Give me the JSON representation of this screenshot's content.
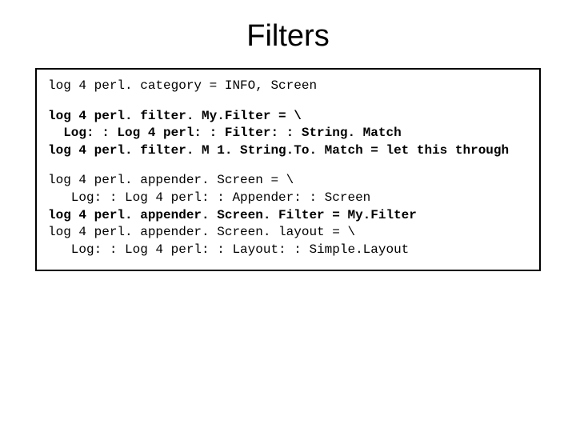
{
  "title": "Filters",
  "code": {
    "l1": "log 4 perl. category = INFO, Screen",
    "l2": "log 4 perl. filter. My.Filter = \\",
    "l3": "  Log: : Log 4 perl: : Filter: : String. Match",
    "l4": "log 4 perl. filter. M 1. String.To. Match = let this through",
    "l5": "log 4 perl. appender. Screen = \\",
    "l6": "   Log: : Log 4 perl: : Appender: : Screen",
    "l7": "log 4 perl. appender. Screen. Filter = My.Filter",
    "l8": "log 4 perl. appender. Screen. layout = \\",
    "l9": "   Log: : Log 4 perl: : Layout: : Simple.Layout"
  }
}
